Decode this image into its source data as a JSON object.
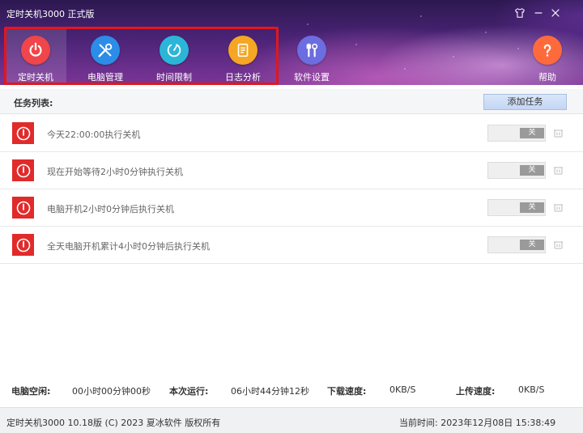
{
  "window": {
    "title": "定时关机3000 正式版"
  },
  "nav": {
    "items": [
      {
        "label": "定时关机",
        "icon": "power-icon",
        "color": "#f0454a",
        "active": true
      },
      {
        "label": "电脑管理",
        "icon": "tools-icon",
        "color": "#2b8de8"
      },
      {
        "label": "时间限制",
        "icon": "timer-icon",
        "color": "#2bb6d8"
      },
      {
        "label": "日志分析",
        "icon": "log-icon",
        "color": "#f5a623"
      },
      {
        "label": "软件设置",
        "icon": "settings-tools-icon",
        "color": "#6b6de0"
      }
    ],
    "help": {
      "label": "帮助",
      "icon": "help-icon",
      "color": "#ff6a3d"
    }
  },
  "tasks": {
    "header_label": "任务列表:",
    "add_label": "添加任务",
    "items": [
      {
        "text": "今天22:00:00执行关机",
        "toggle": "关"
      },
      {
        "text": "现在开始等待2小时0分钟执行关机",
        "toggle": "关"
      },
      {
        "text": "电脑开机2小时0分钟后执行关机",
        "toggle": "关"
      },
      {
        "text": "全天电脑开机累计4小时0分钟后执行关机",
        "toggle": "关"
      }
    ]
  },
  "stats": {
    "idle_label": "电脑空闲:",
    "idle_value": "00小时00分钟00秒",
    "run_label": "本次运行:",
    "run_value": "06小时44分钟12秒",
    "down_label": "下载速度:",
    "down_value": "0KB/S",
    "up_label": "上传速度:",
    "up_value": "0KB/S"
  },
  "footer": {
    "copyright": "定时关机3000 10.18版 (C) 2023  夏冰软件 版权所有",
    "time_label": "当前时间:",
    "time_value": "2023年12月08日 15:38:49"
  },
  "colors": {
    "highlight_border": "#e4161b",
    "task_icon": "#e12b2b",
    "header_bg": "#4a2376"
  }
}
